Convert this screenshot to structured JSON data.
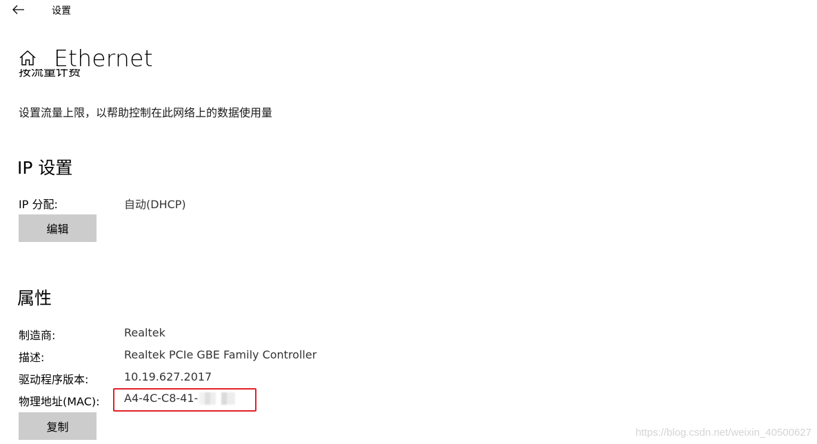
{
  "window": {
    "app_title": "设置",
    "back_icon": "arrow-left-icon"
  },
  "header": {
    "home_icon": "home-icon",
    "title": "Ethernet"
  },
  "metered": {
    "heading_clipped": "按流量计费",
    "description": "设置流量上限，以帮助控制在此网络上的数据使用量"
  },
  "ip_settings": {
    "title": "IP 设置",
    "assignment_label": "IP 分配:",
    "assignment_value": "自动(DHCP)",
    "edit_button": "编辑"
  },
  "properties": {
    "title": "属性",
    "manufacturer_label": "制造商:",
    "manufacturer_value": "Realtek",
    "description_label": "描述:",
    "description_value": "Realtek PCIe GBE Family Controller",
    "driver_label": "驱动程序版本:",
    "driver_value": "10.19.627.2017",
    "mac_label": "物理地址(MAC):",
    "mac_value": "A4-4C-C8-41-",
    "copy_button": "复制"
  },
  "annotation": {
    "highlight_color": "#e21f26"
  },
  "watermark": "https://blog.csdn.net/weixin_40500627"
}
